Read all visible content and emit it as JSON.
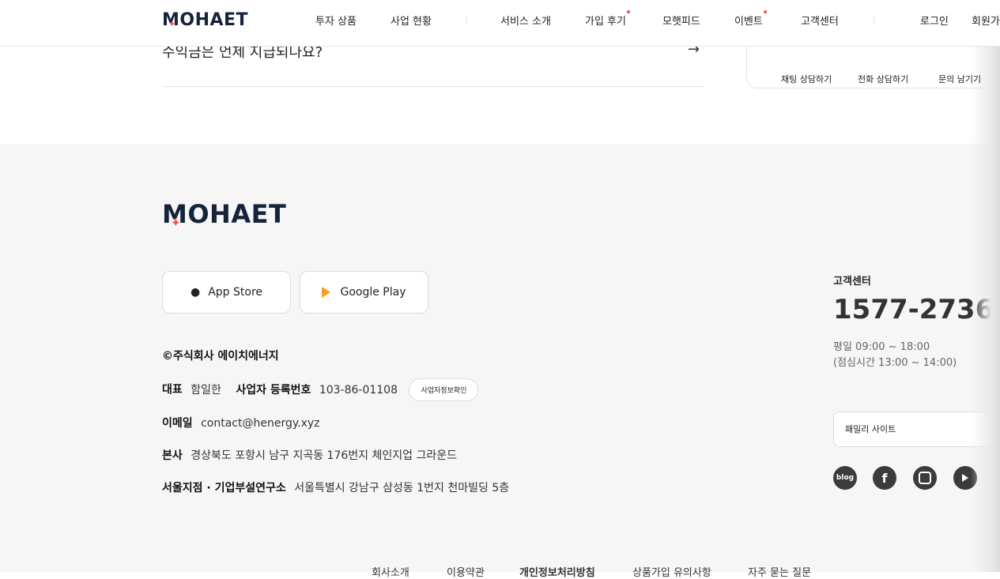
{
  "header": {
    "logo": "MOHAET",
    "nav": [
      {
        "label": "투자 상품"
      },
      {
        "label": "사업 현황"
      },
      {
        "label": "서비스 소개"
      },
      {
        "label": "가입 후기"
      },
      {
        "label": "모햇피드"
      },
      {
        "label": "이벤트"
      },
      {
        "label": "고객센터"
      },
      {
        "label": "로그인"
      },
      {
        "label": "회원가"
      }
    ]
  },
  "faq": {
    "question": "수익금은 언제 지급되나요?",
    "arrow": "→"
  },
  "cs_links": [
    "채팅 상담하기",
    "전화 상담하기",
    "문의 남기기"
  ],
  "footer": {
    "logo": "MOHAET",
    "app_store": "App Store",
    "google_play": "Google Play",
    "company": "©주식회사 에이치에너지",
    "ceo_label": "대표",
    "ceo": "함일한",
    "biz_label": "사업자 등록번호",
    "biz_no": "103-86-01108",
    "biz_btn": "사업자정보확인",
    "email_label": "이메일",
    "email": "contact@henergy.xyz",
    "hq_label": "본사",
    "hq": "경상북도 포항시 남구 지곡동 176번지 체인지업 그라운드",
    "seoul_label": "서울지점 · 기업부설연구소",
    "seoul": "서울특별시 강남구 삼성동 1번지 천마빌딩 5층",
    "cs_title": "고객센터",
    "cs_phone": "1577-2736",
    "cs_hours1": "평일 09:00 ~ 18:00",
    "cs_hours2": "(점심시간 13:00 ~ 14:00)",
    "family_site": "패밀리 사이트",
    "social": [
      "blog",
      "facebook",
      "instagram",
      "youtube"
    ],
    "bottom_links": [
      "회사소개",
      "이용약관",
      "개인정보처리방침",
      "상품가입 유의사항",
      "자주 묻는 질문"
    ]
  },
  "colors": {
    "accent": "#ff4d4d",
    "navy": "#15233b",
    "footer_bg": "#f6f6f6"
  }
}
